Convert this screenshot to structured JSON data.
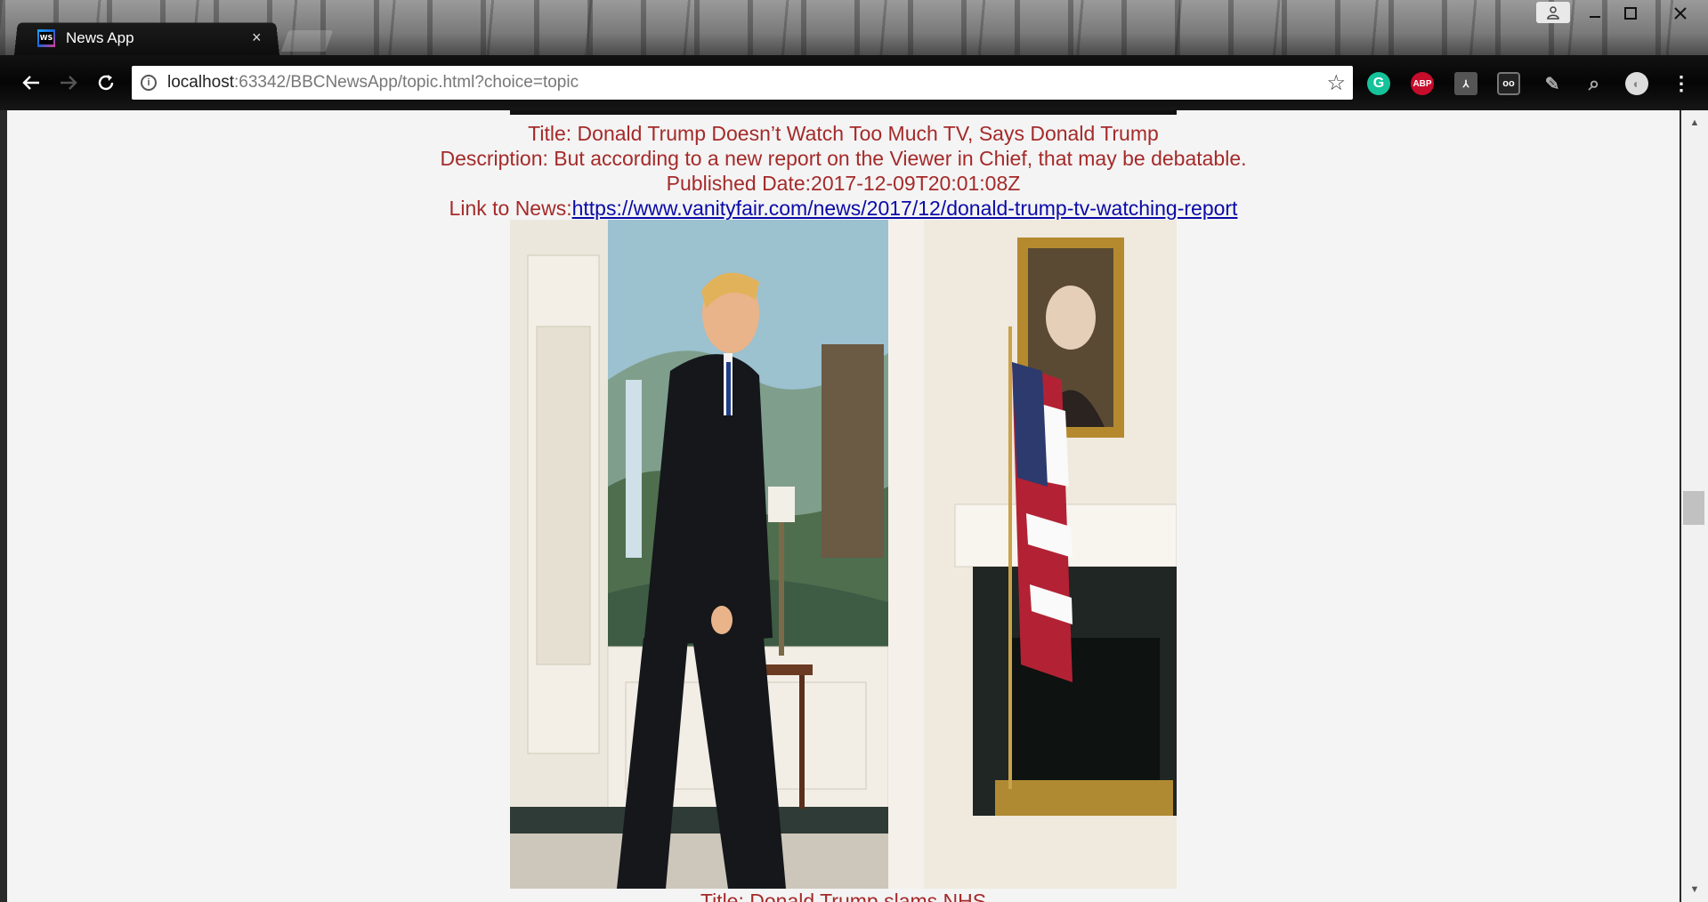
{
  "browser": {
    "tab_title": "News App",
    "tab_close": "×",
    "url_host": "localhost",
    "url_rest": ":63342/BBCNewsApp/topic.html?choice=topic",
    "extensions": [
      {
        "name": "grammarly-icon",
        "glyph": "G",
        "color": "#15c39a"
      },
      {
        "name": "adblock-icon",
        "glyph": "ABP",
        "color": "#c70d2c"
      },
      {
        "name": "pdf-icon",
        "glyph": "⅄",
        "color": "#555555"
      },
      {
        "name": "glasses-icon",
        "glyph": "oo",
        "color": "#444444"
      },
      {
        "name": "pen-icon",
        "glyph": "✎",
        "color": "#444444"
      },
      {
        "name": "search-icon",
        "glyph": "⌕",
        "color": "#222222"
      },
      {
        "name": "circle-extension-icon",
        "glyph": "◐",
        "color": "#dddddd"
      }
    ]
  },
  "article": {
    "title": "Title: Donald Trump Doesn’t Watch Too Much TV, Says Donald Trump",
    "description": "Description: But according to a new report on the Viewer in Chief, that may be debatable.",
    "published": "Published Date:2017-12-09T20:01:08Z",
    "link_label": "Link to News:",
    "link_url": "https://www.vanityfair.com/news/2017/12/donald-trump-tv-watching-report"
  },
  "next_article": {
    "title": "Title: Donald Trump slams NHS"
  }
}
